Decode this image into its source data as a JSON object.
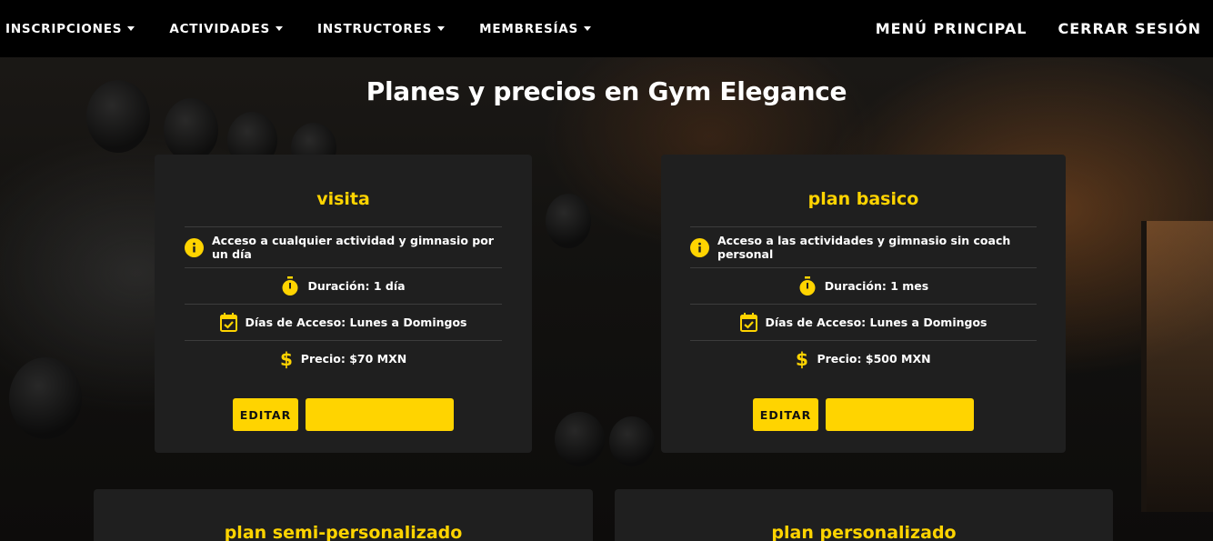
{
  "nav": {
    "left": [
      {
        "label": "INSCRIPCIONES"
      },
      {
        "label": "ACTIVIDADES"
      },
      {
        "label": "INSTRUCTORES"
      },
      {
        "label": "MEMBRESÍAS"
      }
    ],
    "right": [
      {
        "label": "MENÚ PRINCIPAL"
      },
      {
        "label": "CERRAR SESIÓN"
      }
    ]
  },
  "page_title": "Planes y precios en Gym Elegance",
  "colors": {
    "accent": "#ffd400",
    "card_bg": "#1f1f1f",
    "navbar_bg": "#000000"
  },
  "plans": [
    {
      "name": "visita",
      "description": "Acceso a cualquier actividad y gimnasio por un día",
      "duration": "Duración: 1 día",
      "access_days": "Días de Acceso: Lunes a Domingos",
      "price": "Precio: $70 MXN",
      "edit_label": "EDITAR"
    },
    {
      "name": "plan basico",
      "description": "Acceso a las actividades y gimnasio sin coach personal",
      "duration": "Duración: 1 mes",
      "access_days": "Días de Acceso: Lunes a Domingos",
      "price": "Precio: $500 MXN",
      "edit_label": "EDITAR"
    },
    {
      "name": "plan semi-personalizado"
    },
    {
      "name": "plan personalizado"
    }
  ],
  "icons": {
    "info": "info-circle-icon",
    "duration": "stopwatch-icon",
    "days": "calendar-check-icon",
    "price": "dollar-icon"
  }
}
